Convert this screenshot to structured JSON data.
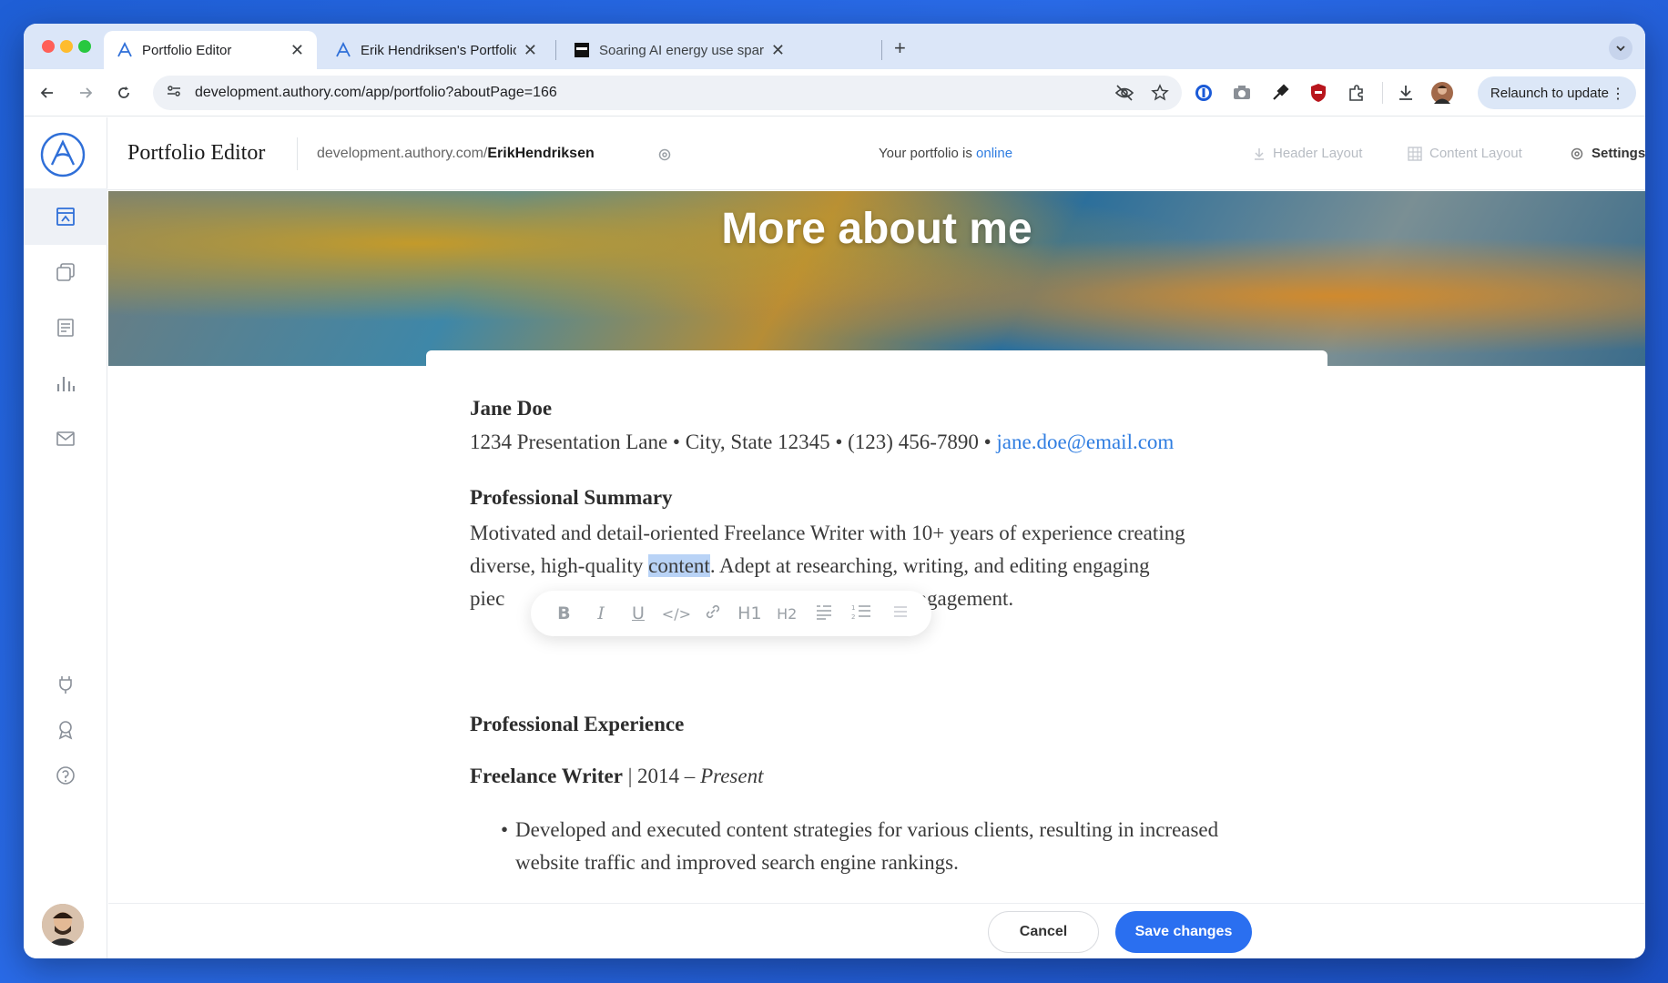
{
  "browser": {
    "tabs": [
      {
        "title": "Portfolio Editor",
        "active": true
      },
      {
        "title": "Erik Hendriksen's Portfolio",
        "active": false
      },
      {
        "title": "Soaring AI energy use sparks",
        "active": false
      }
    ],
    "url": "development.authory.com/app/portfolio?aboutPage=166",
    "relaunch_label": "Relaunch to update"
  },
  "app": {
    "title": "Portfolio Editor",
    "portfolio_url_prefix": "development.authory.com/",
    "portfolio_url_user": "ErikHendriksen",
    "status_prefix": "Your portfolio is ",
    "status_value": "online",
    "header_actions": {
      "header_layout": "Header Layout",
      "content_layout": "Content Layout",
      "settings": "Settings"
    }
  },
  "page": {
    "banner_title": "More about me",
    "resume": {
      "name": "Jane Doe",
      "contact_text": "1234 Presentation Lane • City, State 12345 • (123) 456-7890 • ",
      "email": "jane.doe@email.com",
      "summary_heading": "Professional Summary",
      "summary_line1": "Motivated and detail-oriented Freelance Writer with 10+ years of experience creating",
      "summary_line2_before": "diverse, high-quality ",
      "summary_selected": "content",
      "summary_line2_after": ". Adept at researching, writing, and editing engaging",
      "summary_line3_start": "piec",
      "summary_line3_end": "engagement.",
      "experience_heading": "Professional Experience",
      "job_title": "Freelance Writer",
      "job_sep": " | 2014 – ",
      "job_period_end": "Present",
      "bullet_1": "Developed and executed content strategies for various clients, resulting in increased website traffic and improved search engine rankings."
    },
    "format_toolbar": [
      "B",
      "I",
      "U",
      "</>",
      "🔗",
      "H1",
      "H2",
      "❝",
      "1≡",
      "≡"
    ]
  },
  "footer": {
    "cancel_label": "Cancel",
    "save_label": "Save changes"
  },
  "colors": {
    "accent": "#2a6ff0",
    "link": "#2f7de1",
    "selection": "#b9d3f6"
  }
}
